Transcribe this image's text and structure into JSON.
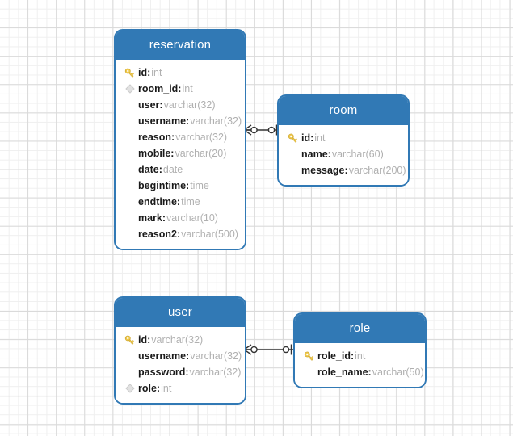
{
  "diagram": {
    "type": "entity-relationship-diagram",
    "background": {
      "grid": true,
      "minor_grid_color": "#efefef",
      "major_grid_color": "#d9d9d9",
      "canvas_color": "#ffffff"
    },
    "theme": {
      "header_color": "#3179b5",
      "border_color": "#3179b5",
      "header_text_color": "#ffffff",
      "field_name_color": "#1a1a1a",
      "field_type_color": "#b0b0b0",
      "key_icon_color": "#efc84a",
      "fk_icon_color": "#cccccc",
      "connector_color": "#333333"
    },
    "entities": [
      {
        "name": "reservation",
        "fields": [
          {
            "icon": "primary-key-icon",
            "name": "id",
            "type": "int"
          },
          {
            "icon": "foreign-key-diamond-icon",
            "name": "room_id",
            "type": "int"
          },
          {
            "icon": "none",
            "name": "user",
            "type": "varchar(32)"
          },
          {
            "icon": "none",
            "name": "username",
            "type": "varchar(32)"
          },
          {
            "icon": "none",
            "name": "reason",
            "type": "varchar(32)"
          },
          {
            "icon": "none",
            "name": "mobile",
            "type": "varchar(20)"
          },
          {
            "icon": "none",
            "name": "date",
            "type": "date"
          },
          {
            "icon": "none",
            "name": "begintime",
            "type": "time"
          },
          {
            "icon": "none",
            "name": "endtime",
            "type": "time"
          },
          {
            "icon": "none",
            "name": "mark",
            "type": "varchar(10)"
          },
          {
            "icon": "none",
            "name": "reason2",
            "type": "varchar(500)"
          }
        ]
      },
      {
        "name": "room",
        "fields": [
          {
            "icon": "primary-key-icon",
            "name": "id",
            "type": "int"
          },
          {
            "icon": "none",
            "name": "name",
            "type": "varchar(60)"
          },
          {
            "icon": "none",
            "name": "message",
            "type": "varchar(200)"
          }
        ]
      },
      {
        "name": "user",
        "fields": [
          {
            "icon": "primary-key-icon",
            "name": "id",
            "type": "varchar(32)"
          },
          {
            "icon": "none",
            "name": "username",
            "type": "varchar(32)"
          },
          {
            "icon": "none",
            "name": "password",
            "type": "varchar(32)"
          },
          {
            "icon": "foreign-key-diamond-icon",
            "name": "role",
            "type": "int"
          }
        ]
      },
      {
        "name": "role",
        "fields": [
          {
            "icon": "primary-key-icon",
            "name": "role_id",
            "type": "int"
          },
          {
            "icon": "none",
            "name": "role_name",
            "type": "varchar(50)"
          }
        ]
      }
    ],
    "relationships": [
      {
        "from": "reservation",
        "to": "room",
        "from_cardinality": "zero-or-many",
        "to_cardinality": "zero-or-one"
      },
      {
        "from": "user",
        "to": "role",
        "from_cardinality": "zero-or-many",
        "to_cardinality": "zero-or-one"
      }
    ]
  }
}
